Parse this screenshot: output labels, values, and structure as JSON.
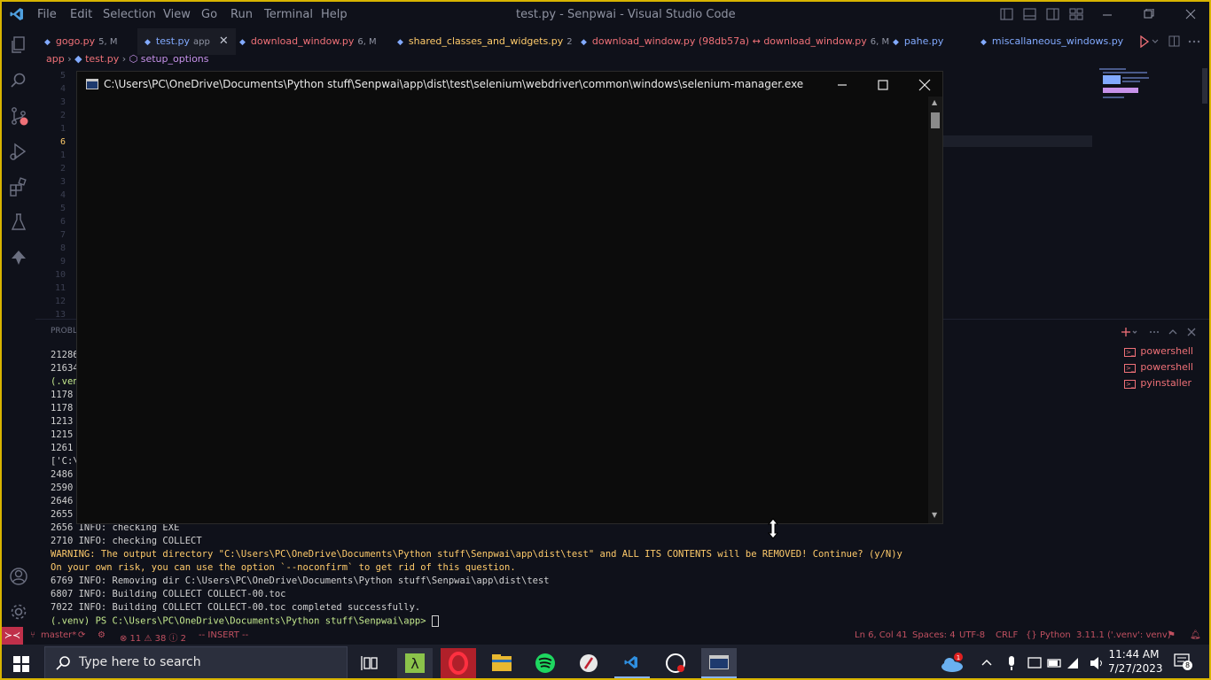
{
  "window": {
    "title": "test.py - Senpwai - Visual Studio Code",
    "menu": [
      "File",
      "Edit",
      "Selection",
      "View",
      "Go",
      "Run",
      "Terminal",
      "Help"
    ]
  },
  "tabs": [
    {
      "label": "gogo.py",
      "badge": "5, M",
      "color": "#f07178"
    },
    {
      "label": "test.py",
      "badge": "app",
      "color": "#82aaff"
    },
    {
      "label": "download_window.py",
      "badge": "6, M",
      "color": "#f07178"
    },
    {
      "label": "shared_classes_and_widgets.py",
      "badge": "2",
      "color": "#ffcb6b"
    },
    {
      "label": "download_window.py (98db57a) ↔ download_window.py",
      "badge": "6, M",
      "color": "#f07178"
    },
    {
      "label": "pahe.py",
      "badge": "",
      "color": "#82aaff"
    },
    {
      "label": "miscallaneous_windows.py",
      "badge": "",
      "color": "#82aaff"
    }
  ],
  "breadcrumb": {
    "root": "app",
    "file": "test.py",
    "symbol": "setup_options"
  },
  "gutter": [
    "5",
    "4",
    "3",
    "2",
    "1",
    "6",
    "1",
    "2",
    "3",
    "4",
    "5",
    "6",
    "7",
    "8",
    "9",
    "10",
    "11",
    "12",
    "13"
  ],
  "panel": {
    "tab_label": "PROBL",
    "terminals": [
      "powershell",
      "powershell",
      "pyinstaller"
    ],
    "partial_lines": [
      "21286",
      "21634",
      "(.ven",
      "1178",
      "1178",
      "1213",
      "1215",
      "1261",
      "['C:\\",
      "2486",
      "2590",
      "2646",
      "2655"
    ],
    "lines": [
      "2656 INFO: checking EXE",
      "2710 INFO: checking COLLECT",
      "WARNING: The output directory \"C:\\Users\\PC\\OneDrive\\Documents\\Python stuff\\Senpwai\\app\\dist\\test\" and ALL ITS CONTENTS will be REMOVED! Continue? (y/N)y",
      "On your own risk, you can use the option `--noconfirm` to get rid of this question.",
      "6769 INFO: Removing dir C:\\Users\\PC\\OneDrive\\Documents\\Python stuff\\Senpwai\\app\\dist\\test",
      "6807 INFO: Building COLLECT COLLECT-00.toc",
      "7022 INFO: Building COLLECT COLLECT-00.toc completed successfully.",
      "(.venv) PS C:\\Users\\PC\\OneDrive\\Documents\\Python stuff\\Senpwai\\app> "
    ]
  },
  "popup": {
    "title": "C:\\Users\\PC\\OneDrive\\Documents\\Python stuff\\Senpwai\\app\\dist\\test\\selenium\\webdriver\\common\\windows\\selenium-manager.exe"
  },
  "status": {
    "branch": "master*",
    "problems": "⊗ 11 ⚠ 38 ⓘ 2",
    "mode": "-- INSERT --",
    "position": "Ln 6, Col 41",
    "spaces": "Spaces: 4",
    "encoding": "UTF-8",
    "eol": "CRLF",
    "language": "Python",
    "interpreter": "3.11.1 ('.venv': venv)"
  },
  "taskbar": {
    "search_placeholder": "Type here to search",
    "time": "11:44 AM",
    "date": "7/27/2023",
    "notifications": "8",
    "cloud_badge": "1"
  }
}
